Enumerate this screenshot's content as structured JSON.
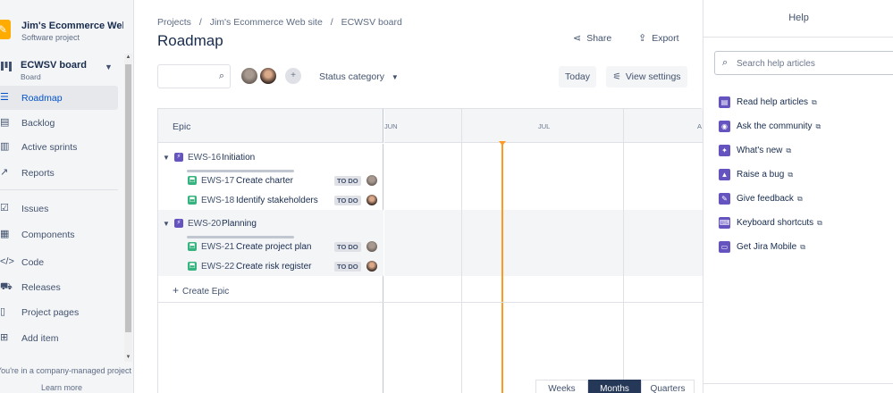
{
  "sidebar": {
    "project_name": "Jim's Ecommerce Web s...",
    "project_type": "Software project",
    "board_name": "ECWSV board",
    "board_sub": "Board",
    "items": [
      {
        "label": "Roadmap",
        "icon": "roadmap-icon",
        "active": true
      },
      {
        "label": "Backlog",
        "icon": "backlog-icon"
      },
      {
        "label": "Active sprints",
        "icon": "sprints-icon"
      },
      {
        "label": "Reports",
        "icon": "reports-icon"
      },
      {
        "label": "Issues",
        "icon": "issues-icon"
      },
      {
        "label": "Components",
        "icon": "components-icon"
      },
      {
        "label": "Code",
        "icon": "code-icon"
      },
      {
        "label": "Releases",
        "icon": "releases-icon"
      },
      {
        "label": "Project pages",
        "icon": "pages-icon"
      },
      {
        "label": "Add item",
        "icon": "add-item-icon"
      }
    ],
    "footer_note": "You're in a company-managed project",
    "footer_link": "Learn more"
  },
  "header": {
    "breadcrumbs": [
      "Projects",
      "/",
      "Jim's Ecommerce Web site",
      "/",
      "ECWSV board"
    ],
    "title": "Roadmap",
    "share_label": "Share",
    "export_label": "Export"
  },
  "toolbar": {
    "search_placeholder": "",
    "status_filter": "Status category",
    "today_label": "Today",
    "view_settings_label": "View settings"
  },
  "roadmap": {
    "epic_header": "Epic",
    "months": [
      "JUN",
      "JUL",
      "A"
    ],
    "rows": [
      {
        "type": "epic",
        "key": "EWS-16",
        "summary": "Initiation"
      },
      {
        "type": "story",
        "key": "EWS-17",
        "summary": "Create charter",
        "status": "TO DO"
      },
      {
        "type": "story",
        "key": "EWS-18",
        "summary": "Identify stakeholders",
        "status": "TO DO"
      },
      {
        "type": "epic",
        "key": "EWS-20",
        "summary": "Planning"
      },
      {
        "type": "story",
        "key": "EWS-21",
        "summary": "Create project plan",
        "status": "TO DO"
      },
      {
        "type": "story",
        "key": "EWS-22",
        "summary": "Create risk register",
        "status": "TO DO"
      }
    ],
    "create_epic_label": "Create Epic",
    "zoom": [
      "Weeks",
      "Months",
      "Quarters"
    ],
    "zoom_selected": "Months"
  },
  "help": {
    "title": "Help",
    "search_placeholder": "Search help articles",
    "items": [
      {
        "label": "Read help articles"
      },
      {
        "label": "Ask the community"
      },
      {
        "label": "What's new"
      },
      {
        "label": "Raise a bug"
      },
      {
        "label": "Give feedback"
      },
      {
        "label": "Keyboard shortcuts"
      },
      {
        "label": "Get Jira Mobile"
      }
    ]
  },
  "colors": {
    "brand": "#0052cc",
    "epic": "#6554c0",
    "story": "#36b37e",
    "today_marker": "#ff991f"
  }
}
